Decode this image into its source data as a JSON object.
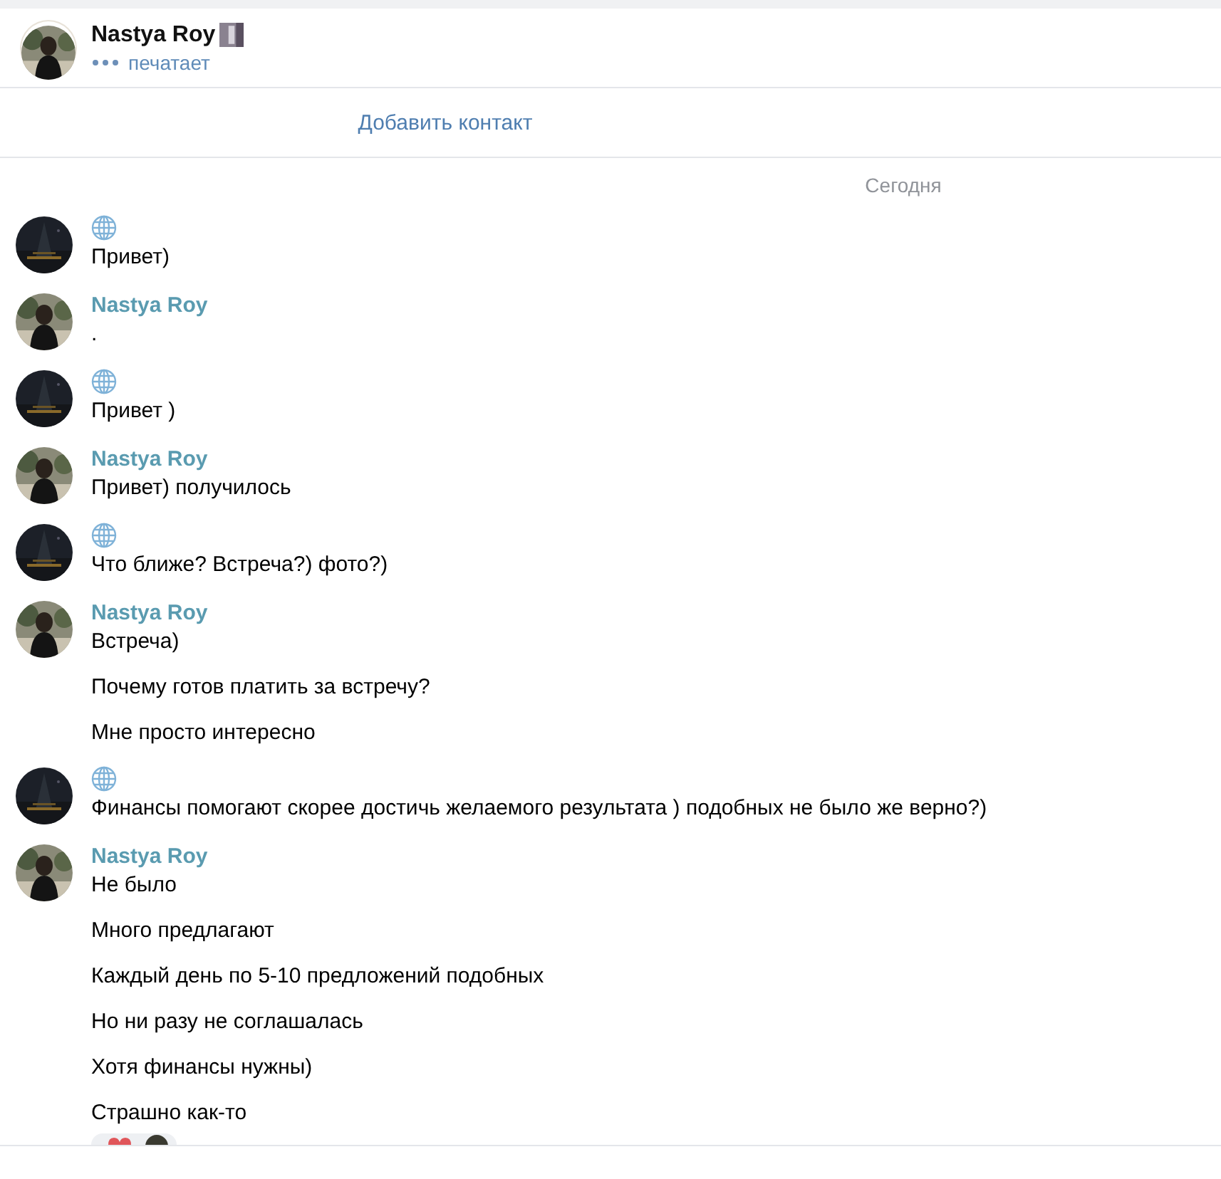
{
  "header": {
    "name": "Nastya Roy",
    "status": "печатает",
    "typing": true
  },
  "add_contact": "Добавить контакт",
  "date": "Сегодня",
  "groups": [
    {
      "kind": "globe",
      "messages": [
        "Привет)"
      ]
    },
    {
      "kind": "contact",
      "sender": "Nastya Roy",
      "messages": [
        "."
      ]
    },
    {
      "kind": "globe",
      "messages": [
        "Привет )"
      ]
    },
    {
      "kind": "contact",
      "sender": "Nastya Roy",
      "messages": [
        "Привет) получилось"
      ]
    },
    {
      "kind": "globe",
      "messages": [
        "Что ближе? Встреча?) фото?)"
      ]
    },
    {
      "kind": "contact",
      "sender": "Nastya Roy",
      "messages": [
        "Встреча)",
        "Почему готов платить за встречу?",
        "Мне просто интересно"
      ]
    },
    {
      "kind": "globe",
      "messages": [
        "Финансы помогают скорее достичь желаемого результата ) подобных не было же верно?)"
      ]
    },
    {
      "kind": "contact",
      "sender": "Nastya Roy",
      "messages": [
        "Не было",
        "Много предлагают",
        "Каждый день по 5-10 предложений подобных",
        "Но ни разу не соглашалась",
        "Хотя финансы нужны)",
        "Страшно как-то"
      ]
    }
  ]
}
